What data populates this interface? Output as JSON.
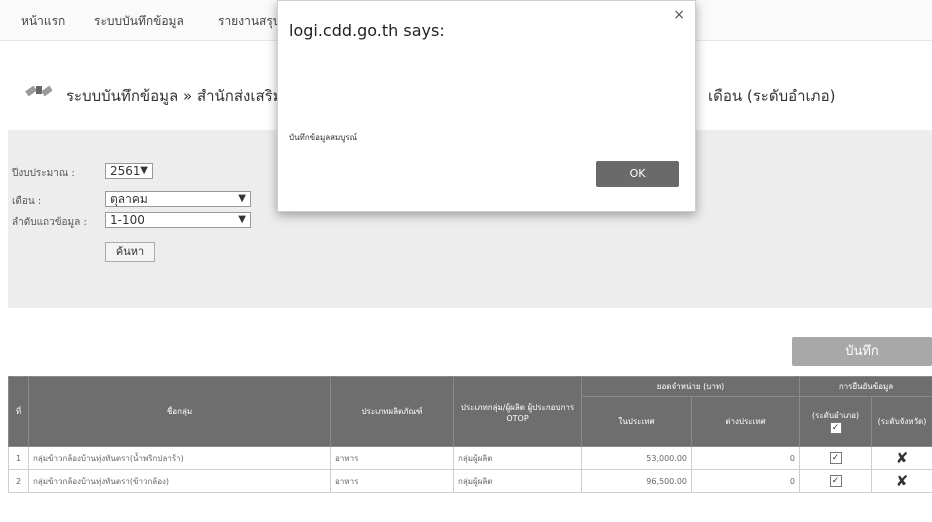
{
  "nav": {
    "items": [
      "หน้าแรก",
      "ระบบบันทึกข้อมูล",
      "รายงานสรุป"
    ]
  },
  "page": {
    "title": "ระบบบันทึกข้อมูล » สำนักส่งเสริม",
    "title_suffix": "เดือน (ระดับอำเภอ)"
  },
  "filters": {
    "year_label": "ปีงบประมาณ :",
    "year_value": "2561",
    "month_label": "เดือน :",
    "month_value": "ตุลาคม",
    "order_label": "ลำดับแถวข้อมูล :",
    "order_value": "1-100",
    "search_label": "ค้นหา"
  },
  "save_label": "บันทึก",
  "table": {
    "headers": {
      "no": "ที่",
      "group": "ชื่อกลุ่ม",
      "product_type": "ประเภทผลิตภัณฑ์",
      "producer_type": "ประเภทกลุ่ม/ผู้ผลิต ผู้ประกอบการ OTOP",
      "sales": "ยอดจำหน่าย (บาท)",
      "sales_domestic": "ในประเทศ",
      "sales_foreign": "ต่างประเทศ",
      "confirm": "การยืนยันข้อมูล",
      "confirm_district": "(ระดับอำเภอ)",
      "confirm_province": "(ระดับจังหวัด)"
    },
    "rows": [
      {
        "no": "1",
        "group": "กลุ่มข้าวกล้องบ้านทุ่งทันตรา(น้ำพริกปลาร้า)",
        "product_type": "อาหาร",
        "producer_type": "กลุ่มผู้ผลิต",
        "domestic": "53,000.00",
        "foreign": "0"
      },
      {
        "no": "2",
        "group": "กลุ่มข้าวกล้องบ้านทุ่งทันตรา(ข้าวกล้อง)",
        "product_type": "อาหาร",
        "producer_type": "กลุ่มผู้ผลิต",
        "domestic": "96,500.00",
        "foreign": "0"
      }
    ]
  },
  "dialog": {
    "title": "logi.cdd.go.th says:",
    "close": "×",
    "message": "บันทึกข้อมูลสมบูรณ์",
    "ok_label": "OK"
  }
}
